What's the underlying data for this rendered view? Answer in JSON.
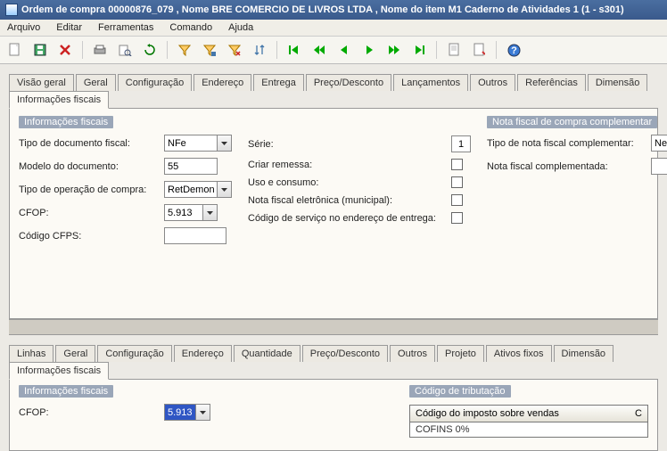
{
  "title": "Ordem de compra 00000876_079 , Nome BRE COMERCIO DE LIVROS LTDA , Nome do item M1 Caderno de Atividades 1 (1 - s301)",
  "menu": {
    "arquivo": "Arquivo",
    "editar": "Editar",
    "ferramentas": "Ferramentas",
    "comando": "Comando",
    "ajuda": "Ajuda"
  },
  "tabs_upper": {
    "visao_geral": "Visão geral",
    "geral": "Geral",
    "configuracao": "Configuração",
    "endereco": "Endereço",
    "entrega": "Entrega",
    "preco": "Preço/Desconto",
    "lancamentos": "Lançamentos",
    "outros": "Outros",
    "referencias": "Referências",
    "dimensao": "Dimensão",
    "info_fiscais": "Informações fiscais"
  },
  "group_info_fiscais": "Informações fiscais",
  "group_nf_comp": "Nota fiscal de compra complementar",
  "labels": {
    "tipo_doc_fiscal": "Tipo de documento fiscal:",
    "modelo_doc": "Modelo do documento:",
    "tipo_op_compra": "Tipo de operação de compra:",
    "cfop": "CFOP:",
    "codigo_cfps": "Código CFPS:",
    "serie": "Série:",
    "criar_remessa": "Criar remessa:",
    "uso_consumo": "Uso e consumo:",
    "nfe_municipal": "Nota fiscal eletrônica (municipal):",
    "cod_serv_entrega": "Código de serviço no endereço de entrega:",
    "tipo_nf_compl": "Tipo de nota fiscal complementar:",
    "nf_complementada": "Nota fiscal complementada:"
  },
  "values": {
    "tipo_doc_fiscal": "NFe",
    "modelo_doc": "55",
    "tipo_op_compra": "RetDemonst",
    "cfop": "5.913",
    "codigo_cfps": "",
    "serie": "1",
    "tipo_nf_compl": "Nenh"
  },
  "tabs_lower": {
    "linhas": "Linhas",
    "geral": "Geral",
    "configuracao": "Configuração",
    "endereco": "Endereço",
    "quantidade": "Quantidade",
    "preco": "Preço/Desconto",
    "outros": "Outros",
    "projeto": "Projeto",
    "ativos": "Ativos fixos",
    "dimensao": "Dimensão",
    "info_fiscais": "Informações fiscais"
  },
  "lower": {
    "group_info_fiscais": "Informações fiscais",
    "group_cod_trib": "Código de tributação",
    "cfop_label": "CFOP:",
    "cfop_value": "5.913",
    "table_header": "Código do imposto sobre vendas",
    "table_sub": "COFINS 0%"
  }
}
